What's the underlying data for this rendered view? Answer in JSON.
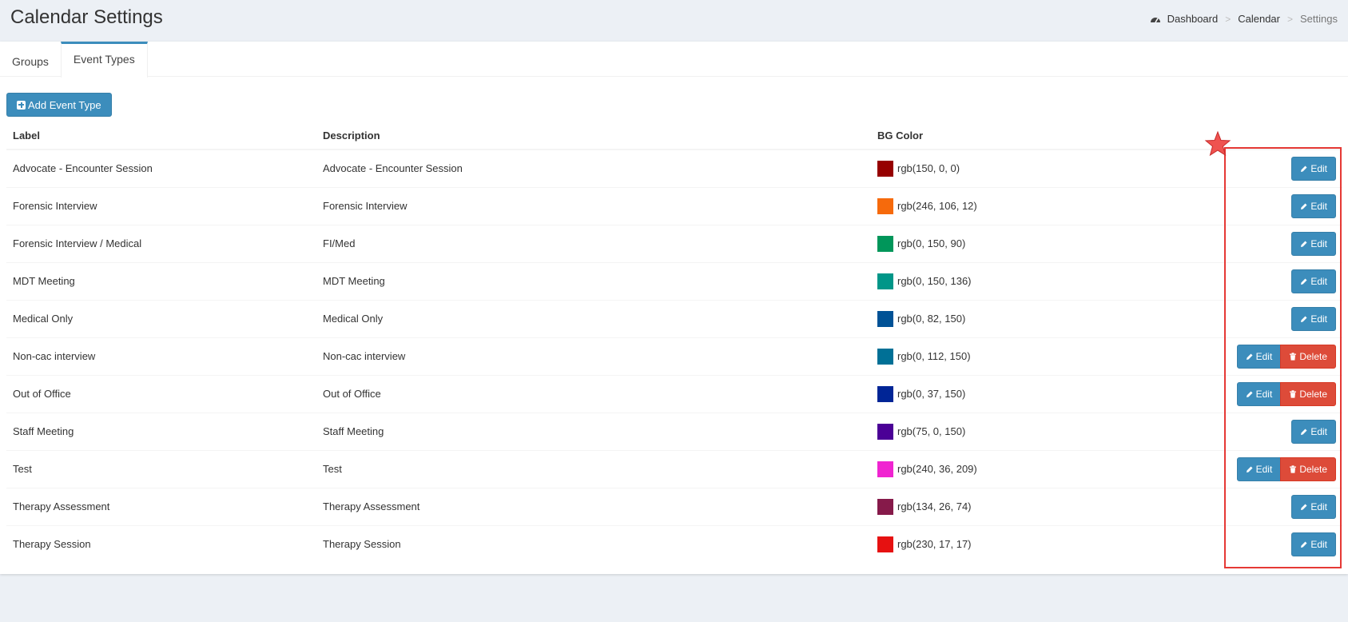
{
  "header": {
    "title": "Calendar Settings",
    "breadcrumb": [
      "Dashboard",
      "Calendar",
      "Settings"
    ]
  },
  "tabs": [
    {
      "label": "Groups",
      "active": false
    },
    {
      "label": "Event Types",
      "active": true
    }
  ],
  "toolbar": {
    "add_label": "Add Event Type"
  },
  "table": {
    "headers": [
      "Label",
      "Description",
      "BG Color",
      ""
    ],
    "rows": [
      {
        "label": "Advocate - Encounter Session",
        "description": "Advocate - Encounter Session",
        "color_text": "rgb(150, 0, 0)",
        "color": "#960000",
        "deletable": false
      },
      {
        "label": "Forensic Interview",
        "description": "Forensic Interview",
        "color_text": "rgb(246, 106, 12)",
        "color": "#f66a0c",
        "deletable": false
      },
      {
        "label": "Forensic Interview / Medical",
        "description": "FI/Med",
        "color_text": "rgb(0, 150, 90)",
        "color": "#00965a",
        "deletable": false
      },
      {
        "label": "MDT Meeting",
        "description": "MDT Meeting",
        "color_text": "rgb(0, 150, 136)",
        "color": "#009688",
        "deletable": false
      },
      {
        "label": "Medical Only",
        "description": "Medical Only",
        "color_text": "rgb(0, 82, 150)",
        "color": "#005296",
        "deletable": false
      },
      {
        "label": "Non-cac interview",
        "description": "Non-cac interview",
        "color_text": "rgb(0, 112, 150)",
        "color": "#007096",
        "deletable": true
      },
      {
        "label": "Out of Office",
        "description": "Out of Office",
        "color_text": "rgb(0, 37, 150)",
        "color": "#002596",
        "deletable": true
      },
      {
        "label": "Staff Meeting",
        "description": "Staff Meeting",
        "color_text": "rgb(75, 0, 150)",
        "color": "#4b0096",
        "deletable": false
      },
      {
        "label": "Test",
        "description": "Test",
        "color_text": "rgb(240, 36, 209)",
        "color": "#f024d1",
        "deletable": true
      },
      {
        "label": "Therapy Assessment",
        "description": "Therapy Assessment",
        "color_text": "rgb(134, 26, 74)",
        "color": "#861a4a",
        "deletable": false
      },
      {
        "label": "Therapy Session",
        "description": "Therapy Session",
        "color_text": "rgb(230, 17, 17)",
        "color": "#e61111",
        "deletable": false
      }
    ],
    "edit_label": "Edit",
    "delete_label": "Delete"
  },
  "colors": {
    "primary": "#3c8dbc",
    "danger": "#dd4b39",
    "highlight": "#e53935"
  }
}
